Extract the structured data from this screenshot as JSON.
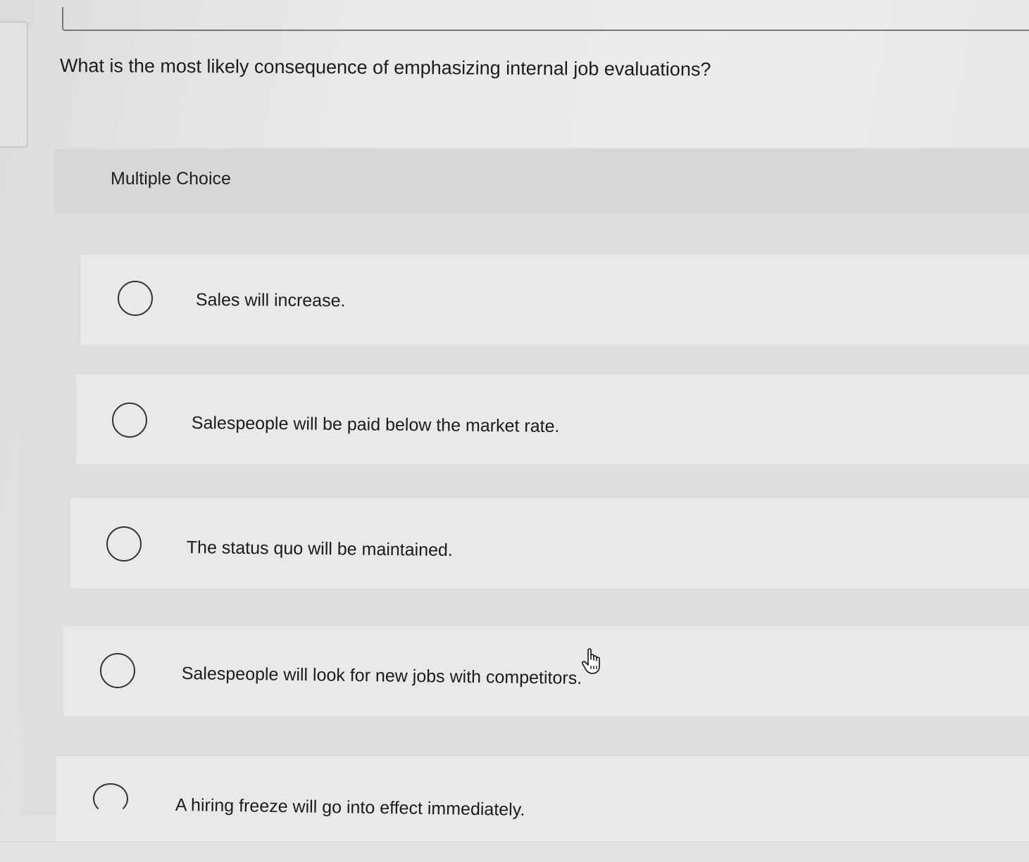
{
  "question": {
    "text": "What is the most likely consequence of emphasizing internal job evaluations?"
  },
  "quiz": {
    "type_label": "Multiple Choice",
    "options": [
      {
        "label": "Sales will increase.",
        "selected": false
      },
      {
        "label": "Salespeople will be paid below the market rate.",
        "selected": false
      },
      {
        "label": "The status quo will be maintained.",
        "selected": false
      },
      {
        "label": "Salespeople will look for new jobs with competitors.",
        "selected": false
      },
      {
        "label": "A hiring freeze will go into effect immediately.",
        "selected": false
      }
    ]
  },
  "pointer": {
    "icon": "hand-pointer-icon"
  }
}
